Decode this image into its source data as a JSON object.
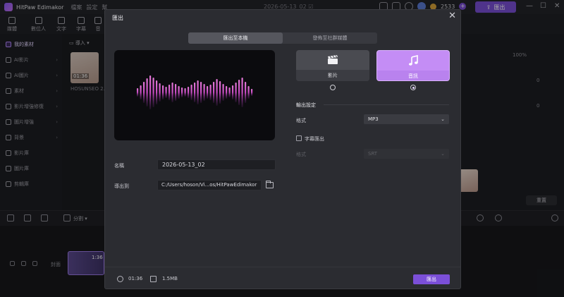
{
  "app": {
    "title": "HitPaw Edimakor",
    "menu": [
      "檔案",
      "設定",
      "幫"
    ],
    "project_date": "2026-05-13_02",
    "credits": "2533",
    "export_label": "匯出",
    "win_controls": [
      "—",
      "☐",
      "✕"
    ]
  },
  "toolbar": {
    "items": [
      "媒體",
      "數位人",
      "文字",
      "字幕",
      "音"
    ]
  },
  "sidebar": {
    "items": [
      {
        "label": "我的素材",
        "icon": "folder-icon"
      },
      {
        "label": "AI影片",
        "icon": "ai-video-icon"
      },
      {
        "label": "AI圖片",
        "icon": "ai-image-icon"
      },
      {
        "label": "素材",
        "icon": "stock-icon"
      },
      {
        "label": "影片增強修復",
        "icon": "enhance-video-icon"
      },
      {
        "label": "圖片增強",
        "icon": "enhance-image-icon"
      },
      {
        "label": "背景",
        "icon": "background-icon"
      },
      {
        "label": "影片庫",
        "icon": "video-library-icon"
      },
      {
        "label": "圖片庫",
        "icon": "image-library-icon"
      },
      {
        "label": "剪輯庫",
        "icon": "clip-library-icon"
      }
    ]
  },
  "media": {
    "import_label": "▭ 導入 ▾",
    "thumb_duration": "01:36",
    "thumb_name": "HOSUNSEO 2..."
  },
  "right_panel": {
    "zoom": "100%",
    "value_a": "0",
    "value_b": "0",
    "reset_label": "重置"
  },
  "timeline": {
    "split_label": "分割 ▾",
    "track_label": "封面",
    "clip_duration": "1:36"
  },
  "dialog": {
    "title": "匯出",
    "close": "✕",
    "tabs": [
      "匯出至本機",
      "發佈至社群媒體"
    ],
    "name_label": "名稱",
    "name_value": "2026-05-13_02",
    "export_to_label": "導出到",
    "export_path": "C:/Users/hoson/Vi...os/HitPawEdimakor",
    "types": [
      {
        "label": "影片",
        "icon": "clapperboard-icon",
        "selected": false
      },
      {
        "label": "音訊",
        "icon": "music-note-icon",
        "selected": true
      }
    ],
    "output_settings_label": "輸出設定",
    "format_label": "格式",
    "format_value": "MP3",
    "subtitle_export_label": "字幕匯出",
    "subtitle_format_label": "格式",
    "subtitle_format_value": "SRT",
    "duration": "01:36",
    "size": "1.5MB",
    "export_button": "匯出",
    "accent_color": "#7b4fd8",
    "selected_card_color": "#c48df5"
  }
}
